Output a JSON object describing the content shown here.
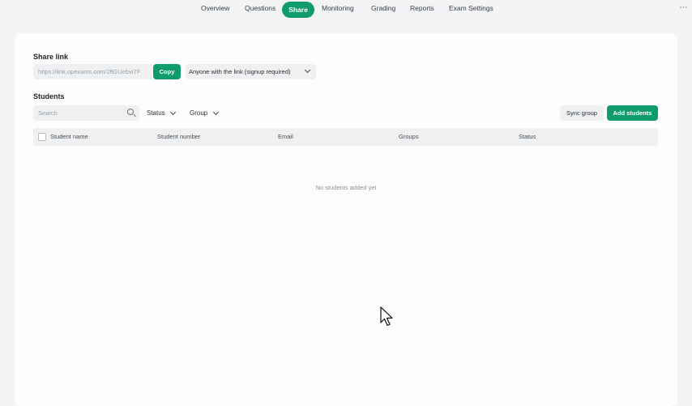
{
  "nav": {
    "tabs": [
      {
        "label": "Overview"
      },
      {
        "label": "Questions"
      },
      {
        "label": "Share",
        "active": true
      },
      {
        "label": "Monitoring"
      },
      {
        "label": "Grading"
      },
      {
        "label": "Reports"
      },
      {
        "label": "Exam Settings"
      }
    ],
    "more_icon": "⋯"
  },
  "share_link": {
    "title": "Share link",
    "url": "https://link.opexams.com/2flGUebvi7F",
    "copy_label": "Copy",
    "access": "Anyone with the link (signup required)"
  },
  "students": {
    "title": "Students",
    "search_placeholder": "Search",
    "filters": {
      "status": "Status",
      "group": "Group"
    },
    "sync_label": "Sync group",
    "add_label": "Add students",
    "columns": [
      "Student name",
      "Student number",
      "Email",
      "Groups",
      "Status"
    ],
    "empty_text": "No students added yet"
  },
  "colors": {
    "accent": "#0f9b6e",
    "page_bg": "#f2f4f6",
    "card_bg": "#fdfdfc",
    "control_bg": "#eef0f2"
  },
  "icons": [
    "search-icon",
    "chevron-down-icon",
    "more-icon",
    "cursor-icon"
  ]
}
